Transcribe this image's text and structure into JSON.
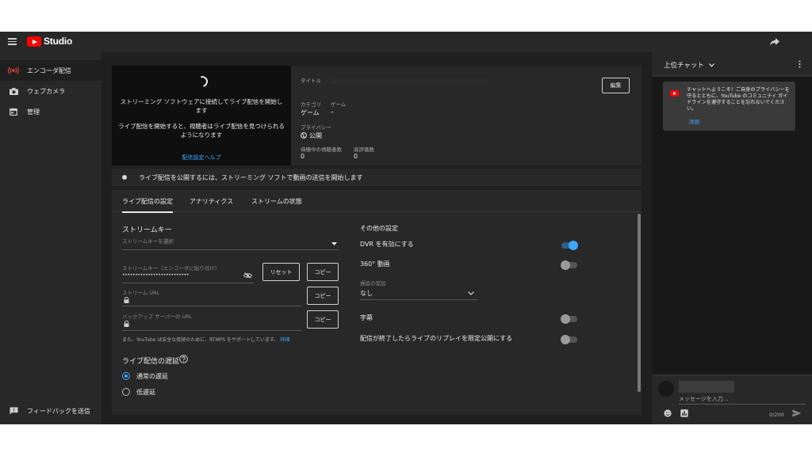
{
  "app": {
    "name": "Studio"
  },
  "sidebar": {
    "items": [
      {
        "label": "エンコーダ配信",
        "icon": "live-broadcast-icon"
      },
      {
        "label": "ウェブカメラ",
        "icon": "camera-icon"
      },
      {
        "label": "管理",
        "icon": "calendar-icon"
      }
    ],
    "feedback": {
      "label": "フィードバックを送信",
      "icon": "feedback-icon"
    }
  },
  "preview": {
    "line1": "ストリーミング ソフトウェアに接続してライブ配信を開始します",
    "line2": "ライブ配信を開始すると、視聴者はライブ配信を見つけられるようになります",
    "help_link": "配信設定ヘルプ"
  },
  "info": {
    "title_label": "タイトル",
    "category_label": "カテゴリ",
    "category_value": "ゲーム",
    "game_label": "ゲーム",
    "game_value": "–",
    "privacy_label": "プライバシー",
    "privacy_value": "公開",
    "waiting_label": "待機中の視聴者数",
    "waiting_value": "0",
    "likes_label": "高評価数",
    "likes_value": "0",
    "edit_button": "編集"
  },
  "status": {
    "text": "ライブ配信を公開するには、ストリーミング ソフトで動画の送信を開始します"
  },
  "tabs": [
    {
      "label": "ライブ配信の設定"
    },
    {
      "label": "アナリティクス"
    },
    {
      "label": "ストリームの状態"
    }
  ],
  "stream_key": {
    "section_title": "ストリームキー",
    "select_label": "ストリームキーを選択",
    "key_label": "ストリームキー（エンコーダに貼り付け）",
    "key_value": "••••••••••••••••••••••••••",
    "reset_button": "リセット",
    "copy_button": "コピー",
    "url_label": "ストリーム URL",
    "backup_label": "バックアップ サーバーの URL",
    "note": "また、YouTube は安全な接続のために、RTMPS をサポートしています。",
    "note_link": "詳細"
  },
  "latency": {
    "title": "ライブ配信の遅延",
    "options": [
      {
        "label": "通常の遅延",
        "selected": true
      },
      {
        "label": "低遅延",
        "selected": false
      }
    ]
  },
  "other": {
    "title": "その他の設定",
    "dvr": {
      "label": "DVR を有効にする",
      "on": true
    },
    "vr360": {
      "label": "360° 動画",
      "on": false
    },
    "delay_label": "遅延の追加",
    "delay_value": "なし",
    "captions": {
      "label": "字幕",
      "on": false
    },
    "unlisted_replay": {
      "label": "配信が終了したらライブのリプレイを限定公開にする",
      "on": false
    }
  },
  "chat": {
    "title": "上位チャット",
    "welcome": "チャットへようこそ！ご自身のプライバシーを守るとともに、YouTube のコミュニティ ガイドラインを遵守することを忘れないでください。",
    "welcome_link": "詳細",
    "input_placeholder": "メッセージを入力...",
    "counter": "0/200"
  },
  "colors": {
    "accent": "#3ea6ff",
    "brand": "#ff0000",
    "background": "#1f1f1f",
    "panel": "#282828"
  }
}
